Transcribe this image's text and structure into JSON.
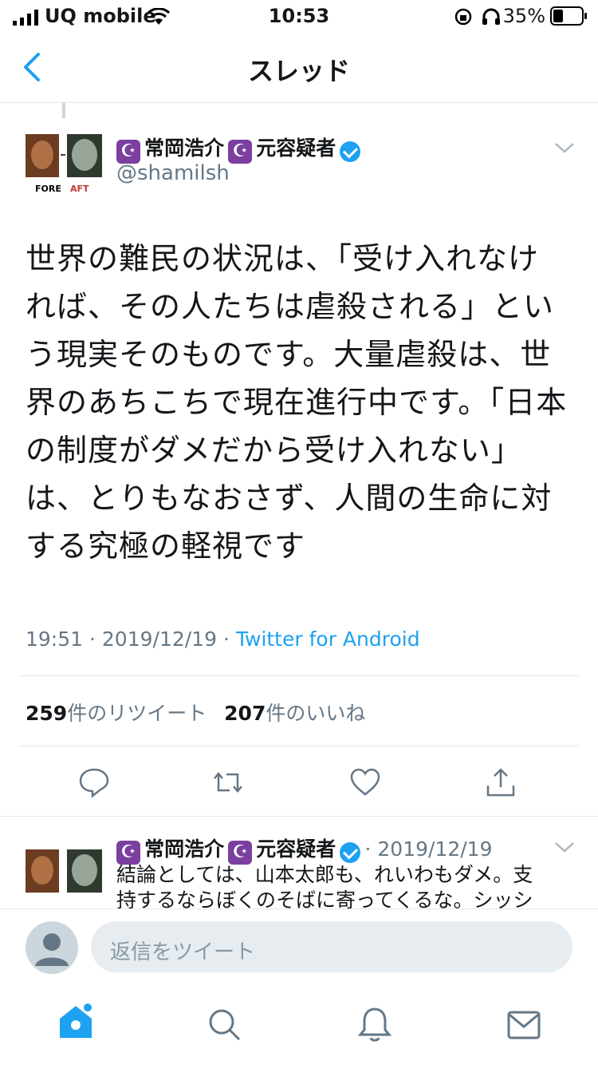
{
  "status_bar": {
    "carrier": "UQ mobile",
    "time": "10:53",
    "battery": "35%"
  },
  "nav": {
    "title": "スレッド"
  },
  "tweet": {
    "avatar_before": "FORE",
    "avatar_after": "AFT",
    "name": "常岡浩介",
    "name_suffix": "元容疑者",
    "handle": "@shamilsh",
    "text": "世界の難民の状況は、「受け入れなければ、その人たちは虐殺される」という現実そのものです。大量虐殺は、世界のあちこちで現在進行中です。「日本の制度がダメだから受け入れない」は、とりもなおさず、人間の生命に対する究極の軽視です",
    "time": "19:51",
    "date": "2019/12/19",
    "source": "Twitter for Android",
    "retweet_count": "259",
    "retweet_label": "件のリツイート",
    "like_count": "207",
    "like_label": "件のいいね"
  },
  "reply": {
    "name": "常岡浩介",
    "name_suffix": "元容疑者",
    "date": "2019/12/19",
    "text_line1": "結論としては、山本太郎も、れいわもダメ。支",
    "text_line2": "持するならぼくのそばに寄ってくるな。シッシ"
  },
  "composer": {
    "placeholder": "返信をツイート"
  },
  "colors": {
    "accent": "#1da1f2",
    "muted": "#657786",
    "divider": "#e1e8ed"
  }
}
